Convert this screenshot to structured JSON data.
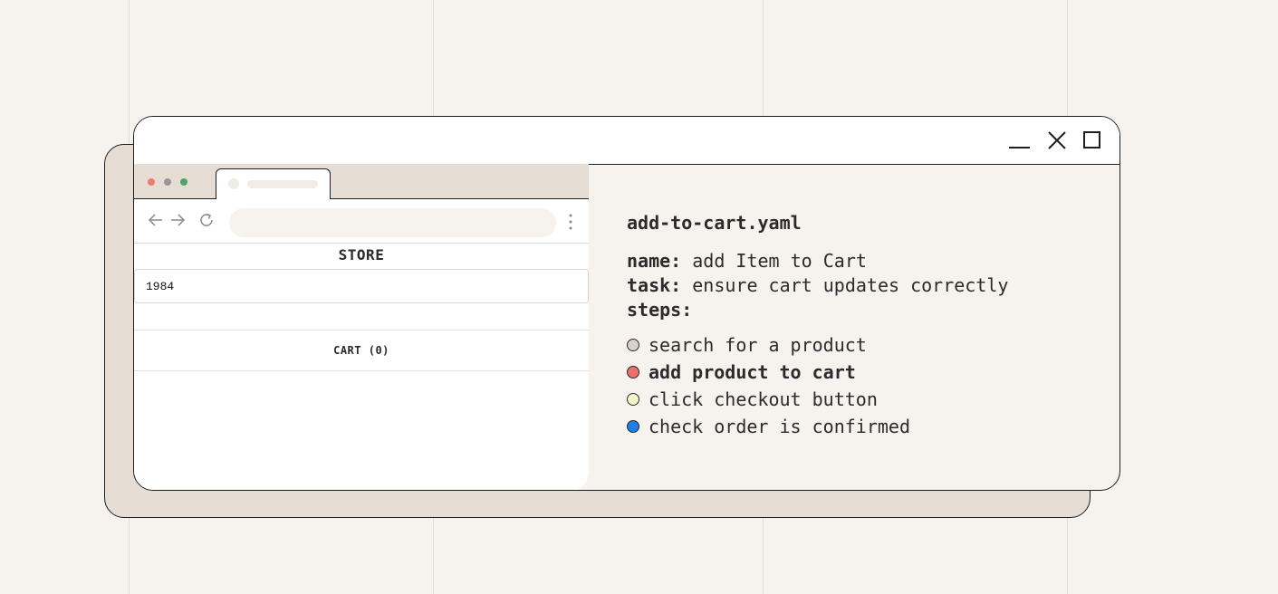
{
  "window_controls": {
    "minimize_icon": "minimize-icon",
    "close_icon": "close-icon",
    "maximize_icon": "maximize-icon"
  },
  "browser": {
    "traffic_lights": [
      "#ee7a73",
      "#9a9592",
      "#4ba26b"
    ],
    "nav_icons": [
      "back-arrow-icon",
      "forward-arrow-icon",
      "reload-icon",
      "more-menu-icon"
    ],
    "address_value": "",
    "store": {
      "title": "STORE",
      "search_value": "1984",
      "cart_label": "CART (0)"
    }
  },
  "yaml": {
    "filename": "add-to-cart.yaml",
    "name_key": "name:",
    "name_value": " add Item to Cart",
    "task_key": "task:",
    "task_value": " ensure cart updates correctly",
    "steps_key": "steps:",
    "steps": [
      {
        "label": "search for a product",
        "color": "#d8d2cb",
        "active": false
      },
      {
        "label": "add product to cart",
        "color": "#ee6e6e",
        "active": true
      },
      {
        "label": "click checkout button",
        "color": "#f2f7c8",
        "active": false
      },
      {
        "label": "check order is confirmed",
        "color": "#1a7fe6",
        "active": false
      }
    ]
  }
}
